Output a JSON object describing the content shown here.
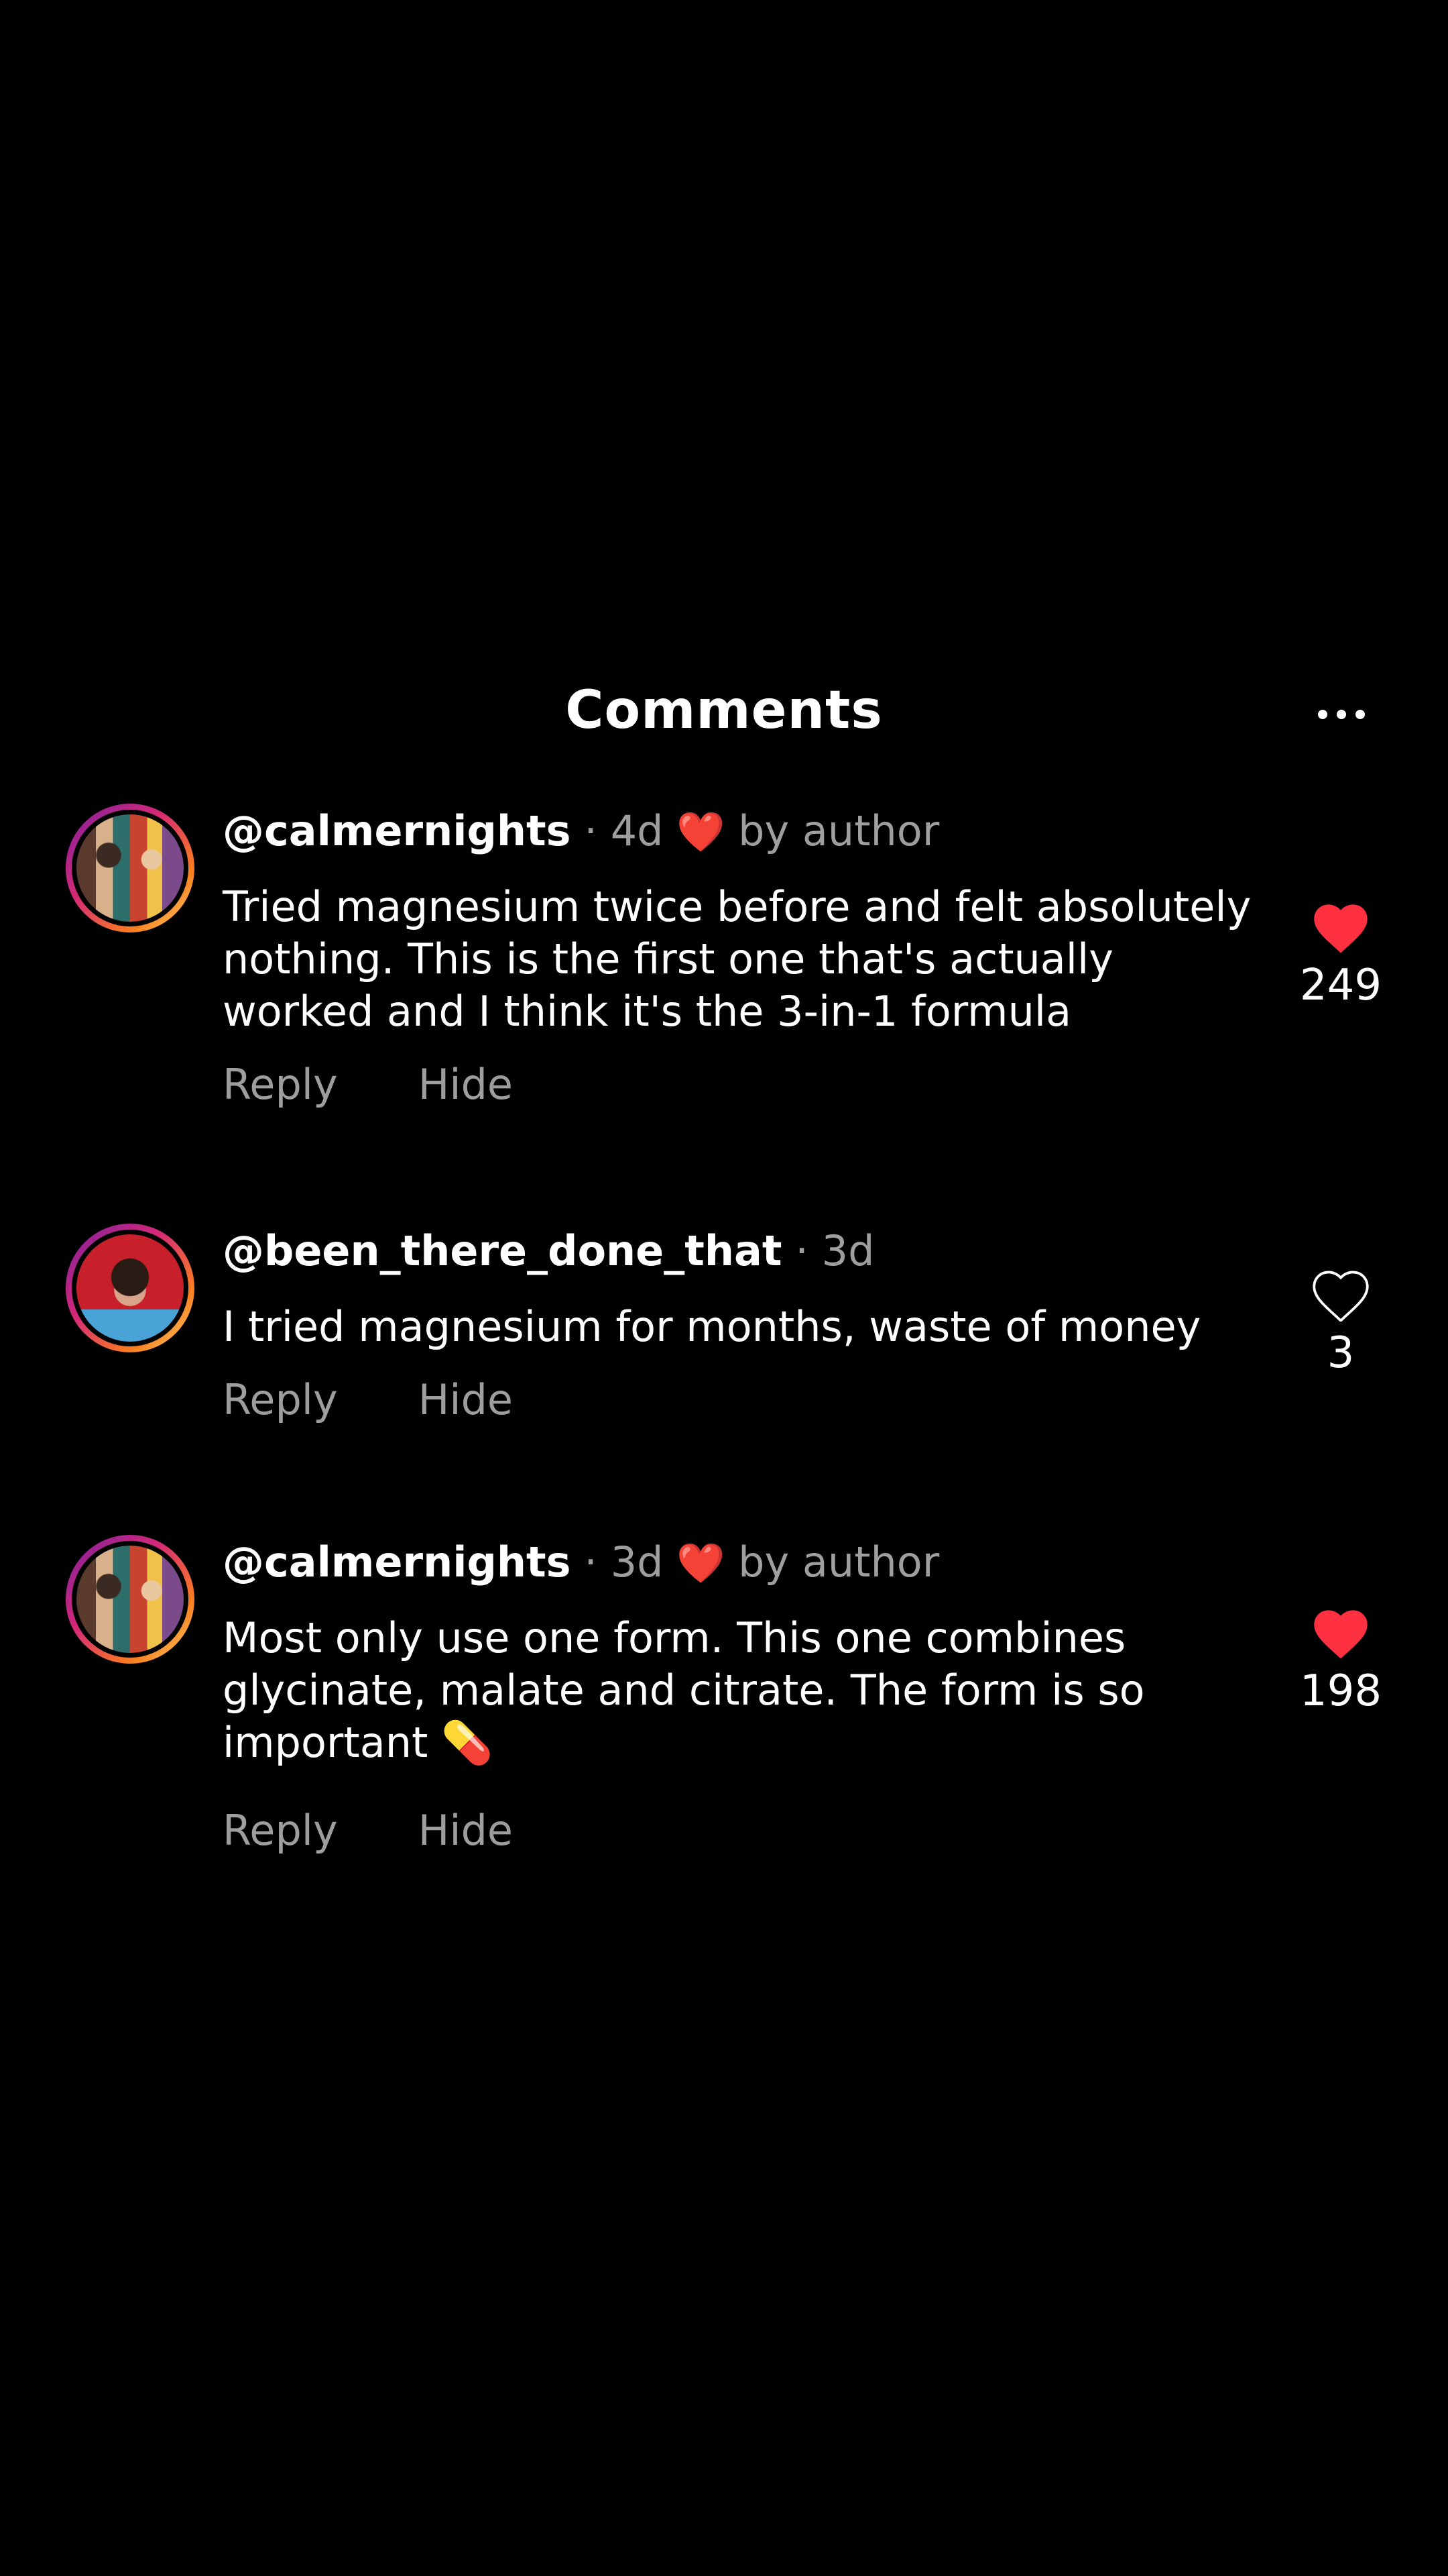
{
  "header": {
    "title": "Comments"
  },
  "icons": {
    "more": "more-horizontal-icon",
    "like_filled": "heart-filled-icon",
    "like_outline": "heart-outline-icon"
  },
  "colors": {
    "background": "#000000",
    "like_red": "#ff3040",
    "secondary_text": "#9e9e9e"
  },
  "comments": [
    {
      "username": "@calmernights",
      "separator": "·",
      "time": "4d",
      "heart": "❤️",
      "liked_by": "by author",
      "text": "Tried magnesium twice before and felt absolutely nothing. This is the first one that's actually worked and I think it's the 3-in-1 formula",
      "reply": "Reply",
      "hide": "Hide",
      "likes": "249",
      "liked": true
    },
    {
      "username": "@been_there_done_that",
      "separator": "·",
      "time": "3d",
      "text": "I tried magnesium for months, waste of money",
      "reply": "Reply",
      "hide": "Hide",
      "likes": "3",
      "liked": false
    },
    {
      "username": "@calmernights",
      "separator": "·",
      "time": "3d",
      "heart": "❤️",
      "liked_by": "by author",
      "text": "Most only use one form. This one combines glycinate, malate and citrate. The form is so important 💊",
      "reply": "Reply",
      "hide": "Hide",
      "likes": "198",
      "liked": true
    }
  ]
}
